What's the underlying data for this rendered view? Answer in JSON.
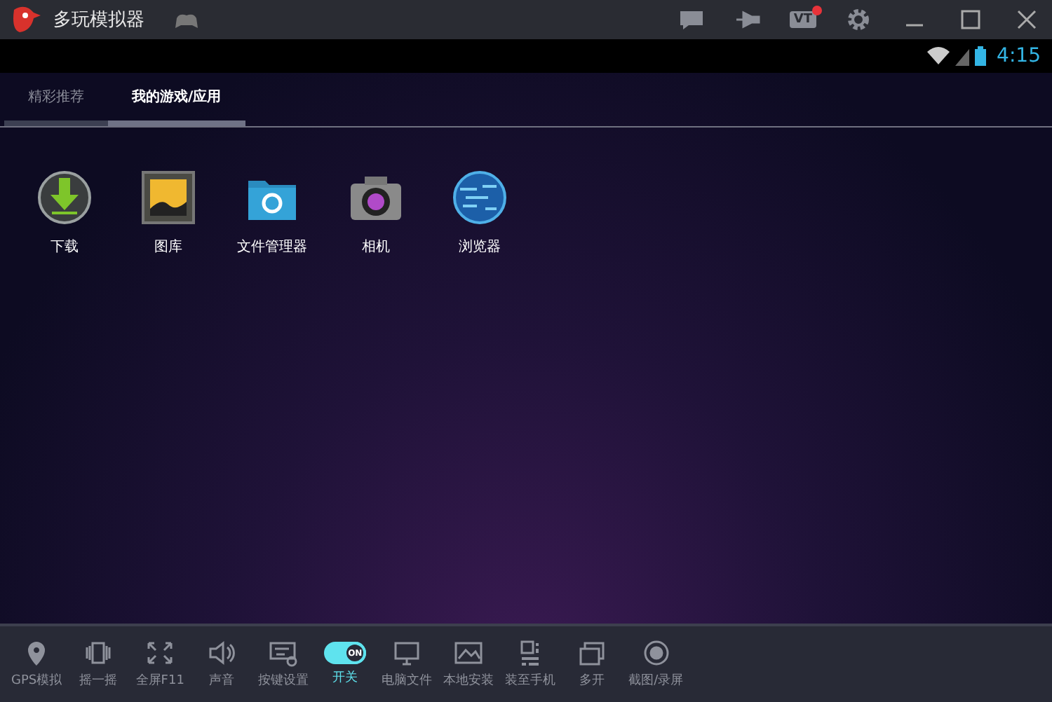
{
  "window": {
    "title": "多玩模拟器",
    "vt_label": "VT",
    "vt_notification": true
  },
  "status_bar": {
    "time": "4:15"
  },
  "tabs": [
    {
      "label": "精彩推荐",
      "selected": false
    },
    {
      "label": "我的游戏/应用",
      "selected": true
    }
  ],
  "apps": [
    {
      "label": "下载"
    },
    {
      "label": "图库"
    },
    {
      "label": "文件管理器"
    },
    {
      "label": "相机"
    },
    {
      "label": "浏览器"
    }
  ],
  "toolbar": [
    {
      "kind": "button",
      "label": "GPS模拟"
    },
    {
      "kind": "button",
      "label": "摇一摇"
    },
    {
      "kind": "button",
      "label": "全屏F11"
    },
    {
      "kind": "button",
      "label": "声音"
    },
    {
      "kind": "button",
      "label": "按键设置"
    },
    {
      "kind": "toggle",
      "label": "开关",
      "on": true,
      "toggle_text": "ON"
    },
    {
      "kind": "button",
      "label": "电脑文件"
    },
    {
      "kind": "button",
      "label": "本地安装"
    },
    {
      "kind": "button",
      "label": "装至手机"
    },
    {
      "kind": "button",
      "label": "多开"
    },
    {
      "kind": "button",
      "label": "截图/录屏"
    }
  ]
}
